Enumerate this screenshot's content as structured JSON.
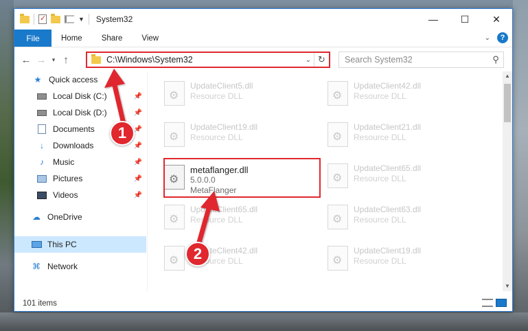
{
  "window": {
    "title": "System32",
    "controls": {
      "minimize": "—",
      "maximize": "☐",
      "close": "✕"
    }
  },
  "ribbon": {
    "file_tab": "File",
    "tabs": [
      "Home",
      "Share",
      "View"
    ],
    "help": "?"
  },
  "address": {
    "path": "C:\\Windows\\System32",
    "search_placeholder": "Search System32"
  },
  "nav": {
    "items": [
      {
        "label": "Quick access",
        "icon": "star-icon",
        "pinned": false
      },
      {
        "label": "Local Disk (C:)",
        "icon": "drive-icon",
        "pinned": true
      },
      {
        "label": "Local Disk (D:)",
        "icon": "drive-icon",
        "pinned": true
      },
      {
        "label": "Documents",
        "icon": "documents-icon",
        "pinned": true
      },
      {
        "label": "Downloads",
        "icon": "download-icon",
        "pinned": true
      },
      {
        "label": "Music",
        "icon": "music-icon",
        "pinned": true
      },
      {
        "label": "Pictures",
        "icon": "pictures-icon",
        "pinned": true
      },
      {
        "label": "Videos",
        "icon": "videos-icon",
        "pinned": true
      },
      {
        "label": "OneDrive",
        "icon": "cloud-icon",
        "pinned": false
      },
      {
        "label": "This PC",
        "icon": "pc-icon",
        "pinned": false,
        "selected": true
      },
      {
        "label": "Network",
        "icon": "network-icon",
        "pinned": false
      }
    ]
  },
  "files": [
    {
      "name": "UpdateClient5.dll",
      "desc": "Resource DLL"
    },
    {
      "name": "UpdateClient42.dll",
      "desc": "Resource DLL"
    },
    {
      "name": "UpdateClient19.dll",
      "desc": "Resource DLL"
    },
    {
      "name": "UpdateClient21.dll",
      "desc": "Resource DLL"
    },
    {
      "name": "metaflanger.dll",
      "version": "5.0.0.0",
      "desc": "MetaFlanger",
      "highlighted": true
    },
    {
      "name": "UpdateClient65.dll",
      "desc": "Resource DLL"
    },
    {
      "name": "UpdateClient65.dll",
      "desc": "Resource DLL"
    },
    {
      "name": "UpdateClient63.dll",
      "desc": "Resource DLL"
    },
    {
      "name": "UpdateClient42.dll",
      "desc": "Resource DLL"
    },
    {
      "name": "UpdateClient19.dll",
      "desc": "Resource DLL"
    }
  ],
  "status": {
    "item_count": "101 items"
  },
  "annotations": {
    "step1": "1",
    "step2": "2",
    "color": "#e0282e"
  }
}
